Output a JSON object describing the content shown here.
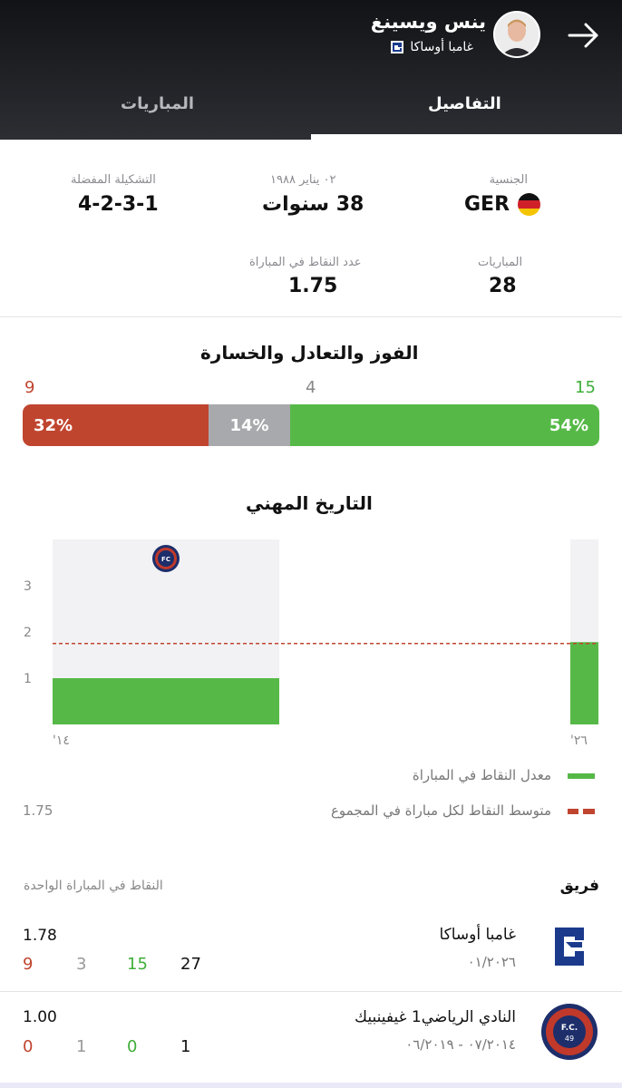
{
  "header": {
    "player_name": "ينس ويسينغ",
    "club": "غامبا أوساكا",
    "tabs": {
      "details": "التفاصيل",
      "matches": "المباريات"
    }
  },
  "info": {
    "nationality_label": "الجنسية",
    "nationality_value": "GER",
    "birth_label": "٠٢ يناير ١٩٨٨",
    "age_value": "38 سنوات",
    "formation_label": "التشكيلة المفضلة",
    "formation_value": "4-2-3-1",
    "matches_label": "المباريات",
    "matches_value": "28",
    "ppg_label": "عدد النقاط في المباراة",
    "ppg_value": "1.75"
  },
  "record": {
    "title": "الفوز والتعادل والخسارة",
    "wins": "15",
    "draws": "4",
    "losses": "9",
    "win_pct": "54%",
    "draw_pct": "14%",
    "loss_pct": "32%",
    "colors": {
      "win": "#56b947",
      "draw": "#a8a9ad",
      "loss": "#c0452f"
    }
  },
  "career": {
    "title": "التاريخ المهني",
    "chart_data": {
      "type": "bar",
      "categories": [
        "'14",
        "'26"
      ],
      "series": [
        {
          "name": "معدل النقاط في المباراة",
          "values": [
            1.0,
            1.78
          ]
        }
      ],
      "average_line": 1.75,
      "y_ticks": [
        "1",
        "2",
        "3"
      ],
      "x_labels": [
        "'١٤",
        "'٢٦"
      ],
      "ylim": [
        0,
        4
      ]
    }
  },
  "legend": {
    "bar_label": "معدل النقاط في المباراة",
    "line_label": "متوسط النقاط لكل مباراة في المجموع",
    "line_value": "1.75"
  },
  "teams": {
    "team_header": "فريق",
    "ppg_header": "النقاط في المباراة الواحدة",
    "rows": [
      {
        "name": "غامبا أوساكا",
        "dates": "٠١/٢٠٢٦",
        "ppg": "1.78",
        "matches": "27",
        "wins": "15",
        "draws": "3",
        "losses": "9"
      },
      {
        "name": "النادي الرياضي1 غيفينبيك",
        "dates": "٠٧/٢٠١٤ - ٠٦/٢٠١٩",
        "ppg": "1.00",
        "matches": "1",
        "wins": "0",
        "draws": "1",
        "losses": "0"
      }
    ]
  }
}
